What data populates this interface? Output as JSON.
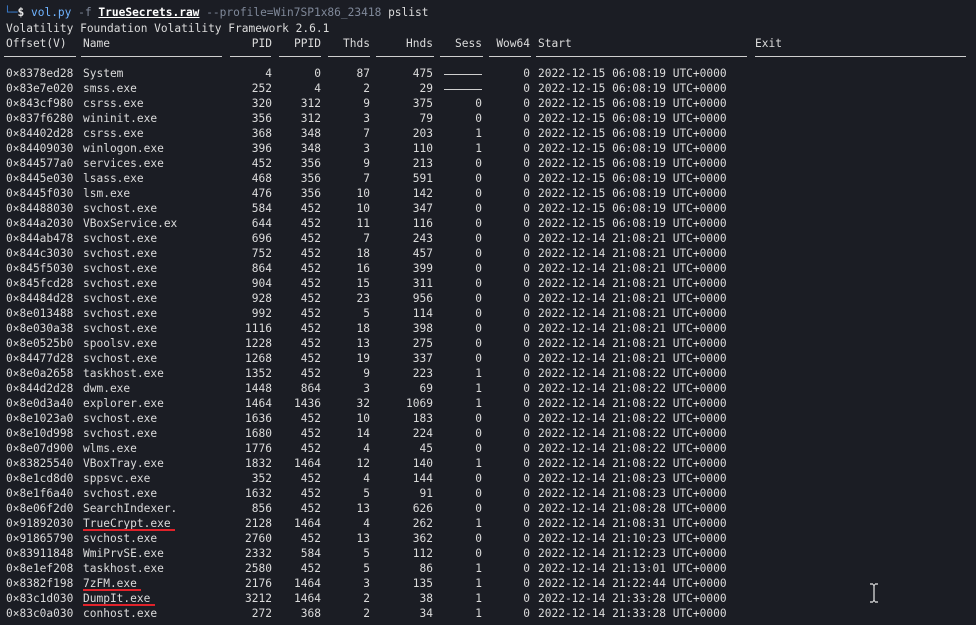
{
  "command": {
    "prompt_prefix": "└─",
    "prompt_symbol": "$",
    "executable": "vol.py",
    "flag_f": "-f",
    "file": "TrueSecrets.raw",
    "profile_arg": "--profile=Win7SP1x86_23418",
    "plugin": "pslist"
  },
  "banner": "Volatility Foundation Volatility Framework 2.6.1",
  "columns": [
    "Offset(V)",
    "Name",
    "PID",
    "PPID",
    "Thds",
    "Hnds",
    "Sess",
    "Wow64",
    "Start",
    "Exit"
  ],
  "rows": [
    {
      "offset": "0×8378ed28",
      "name": "System",
      "pid": "4",
      "ppid": "0",
      "thds": "87",
      "hnds": "475",
      "sess": "—",
      "wow64": "0",
      "start": "2022-12-15 06:08:19 UTC+0000",
      "exit": ""
    },
    {
      "offset": "0×83e7e020",
      "name": "smss.exe",
      "pid": "252",
      "ppid": "4",
      "thds": "2",
      "hnds": "29",
      "sess": "—",
      "wow64": "0",
      "start": "2022-12-15 06:08:19 UTC+0000",
      "exit": ""
    },
    {
      "offset": "0×843cf980",
      "name": "csrss.exe",
      "pid": "320",
      "ppid": "312",
      "thds": "9",
      "hnds": "375",
      "sess": "0",
      "wow64": "0",
      "start": "2022-12-15 06:08:19 UTC+0000",
      "exit": ""
    },
    {
      "offset": "0×837f6280",
      "name": "wininit.exe",
      "pid": "356",
      "ppid": "312",
      "thds": "3",
      "hnds": "79",
      "sess": "0",
      "wow64": "0",
      "start": "2022-12-15 06:08:19 UTC+0000",
      "exit": ""
    },
    {
      "offset": "0×84402d28",
      "name": "csrss.exe",
      "pid": "368",
      "ppid": "348",
      "thds": "7",
      "hnds": "203",
      "sess": "1",
      "wow64": "0",
      "start": "2022-12-15 06:08:19 UTC+0000",
      "exit": ""
    },
    {
      "offset": "0×84409030",
      "name": "winlogon.exe",
      "pid": "396",
      "ppid": "348",
      "thds": "3",
      "hnds": "110",
      "sess": "1",
      "wow64": "0",
      "start": "2022-12-15 06:08:19 UTC+0000",
      "exit": ""
    },
    {
      "offset": "0×844577a0",
      "name": "services.exe",
      "pid": "452",
      "ppid": "356",
      "thds": "9",
      "hnds": "213",
      "sess": "0",
      "wow64": "0",
      "start": "2022-12-15 06:08:19 UTC+0000",
      "exit": ""
    },
    {
      "offset": "0×8445e030",
      "name": "lsass.exe",
      "pid": "468",
      "ppid": "356",
      "thds": "7",
      "hnds": "591",
      "sess": "0",
      "wow64": "0",
      "start": "2022-12-15 06:08:19 UTC+0000",
      "exit": ""
    },
    {
      "offset": "0×8445f030",
      "name": "lsm.exe",
      "pid": "476",
      "ppid": "356",
      "thds": "10",
      "hnds": "142",
      "sess": "0",
      "wow64": "0",
      "start": "2022-12-15 06:08:19 UTC+0000",
      "exit": ""
    },
    {
      "offset": "0×84488030",
      "name": "svchost.exe",
      "pid": "584",
      "ppid": "452",
      "thds": "10",
      "hnds": "347",
      "sess": "0",
      "wow64": "0",
      "start": "2022-12-15 06:08:19 UTC+0000",
      "exit": ""
    },
    {
      "offset": "0×844a2030",
      "name": "VBoxService.ex",
      "pid": "644",
      "ppid": "452",
      "thds": "11",
      "hnds": "116",
      "sess": "0",
      "wow64": "0",
      "start": "2022-12-15 06:08:19 UTC+0000",
      "exit": ""
    },
    {
      "offset": "0×844ab478",
      "name": "svchost.exe",
      "pid": "696",
      "ppid": "452",
      "thds": "7",
      "hnds": "243",
      "sess": "0",
      "wow64": "0",
      "start": "2022-12-14 21:08:21 UTC+0000",
      "exit": ""
    },
    {
      "offset": "0×844c3030",
      "name": "svchost.exe",
      "pid": "752",
      "ppid": "452",
      "thds": "18",
      "hnds": "457",
      "sess": "0",
      "wow64": "0",
      "start": "2022-12-14 21:08:21 UTC+0000",
      "exit": ""
    },
    {
      "offset": "0×845f5030",
      "name": "svchost.exe",
      "pid": "864",
      "ppid": "452",
      "thds": "16",
      "hnds": "399",
      "sess": "0",
      "wow64": "0",
      "start": "2022-12-14 21:08:21 UTC+0000",
      "exit": ""
    },
    {
      "offset": "0×845fcd28",
      "name": "svchost.exe",
      "pid": "904",
      "ppid": "452",
      "thds": "15",
      "hnds": "311",
      "sess": "0",
      "wow64": "0",
      "start": "2022-12-14 21:08:21 UTC+0000",
      "exit": ""
    },
    {
      "offset": "0×84484d28",
      "name": "svchost.exe",
      "pid": "928",
      "ppid": "452",
      "thds": "23",
      "hnds": "956",
      "sess": "0",
      "wow64": "0",
      "start": "2022-12-14 21:08:21 UTC+0000",
      "exit": ""
    },
    {
      "offset": "0×8e013488",
      "name": "svchost.exe",
      "pid": "992",
      "ppid": "452",
      "thds": "5",
      "hnds": "114",
      "sess": "0",
      "wow64": "0",
      "start": "2022-12-14 21:08:21 UTC+0000",
      "exit": ""
    },
    {
      "offset": "0×8e030a38",
      "name": "svchost.exe",
      "pid": "1116",
      "ppid": "452",
      "thds": "18",
      "hnds": "398",
      "sess": "0",
      "wow64": "0",
      "start": "2022-12-14 21:08:21 UTC+0000",
      "exit": ""
    },
    {
      "offset": "0×8e0525b0",
      "name": "spoolsv.exe",
      "pid": "1228",
      "ppid": "452",
      "thds": "13",
      "hnds": "275",
      "sess": "0",
      "wow64": "0",
      "start": "2022-12-14 21:08:21 UTC+0000",
      "exit": ""
    },
    {
      "offset": "0×84477d28",
      "name": "svchost.exe",
      "pid": "1268",
      "ppid": "452",
      "thds": "19",
      "hnds": "337",
      "sess": "0",
      "wow64": "0",
      "start": "2022-12-14 21:08:21 UTC+0000",
      "exit": ""
    },
    {
      "offset": "0×8e0a2658",
      "name": "taskhost.exe",
      "pid": "1352",
      "ppid": "452",
      "thds": "9",
      "hnds": "223",
      "sess": "1",
      "wow64": "0",
      "start": "2022-12-14 21:08:22 UTC+0000",
      "exit": ""
    },
    {
      "offset": "0×844d2d28",
      "name": "dwm.exe",
      "pid": "1448",
      "ppid": "864",
      "thds": "3",
      "hnds": "69",
      "sess": "1",
      "wow64": "0",
      "start": "2022-12-14 21:08:22 UTC+0000",
      "exit": ""
    },
    {
      "offset": "0×8e0d3a40",
      "name": "explorer.exe",
      "pid": "1464",
      "ppid": "1436",
      "thds": "32",
      "hnds": "1069",
      "sess": "1",
      "wow64": "0",
      "start": "2022-12-14 21:08:22 UTC+0000",
      "exit": ""
    },
    {
      "offset": "0×8e1023a0",
      "name": "svchost.exe",
      "pid": "1636",
      "ppid": "452",
      "thds": "10",
      "hnds": "183",
      "sess": "0",
      "wow64": "0",
      "start": "2022-12-14 21:08:22 UTC+0000",
      "exit": ""
    },
    {
      "offset": "0×8e10d998",
      "name": "svchost.exe",
      "pid": "1680",
      "ppid": "452",
      "thds": "14",
      "hnds": "224",
      "sess": "0",
      "wow64": "0",
      "start": "2022-12-14 21:08:22 UTC+0000",
      "exit": ""
    },
    {
      "offset": "0×8e07d900",
      "name": "wlms.exe",
      "pid": "1776",
      "ppid": "452",
      "thds": "4",
      "hnds": "45",
      "sess": "0",
      "wow64": "0",
      "start": "2022-12-14 21:08:22 UTC+0000",
      "exit": ""
    },
    {
      "offset": "0×83825540",
      "name": "VBoxTray.exe",
      "pid": "1832",
      "ppid": "1464",
      "thds": "12",
      "hnds": "140",
      "sess": "1",
      "wow64": "0",
      "start": "2022-12-14 21:08:22 UTC+0000",
      "exit": ""
    },
    {
      "offset": "0×8e1cd8d0",
      "name": "sppsvc.exe",
      "pid": "352",
      "ppid": "452",
      "thds": "4",
      "hnds": "144",
      "sess": "0",
      "wow64": "0",
      "start": "2022-12-14 21:08:23 UTC+0000",
      "exit": ""
    },
    {
      "offset": "0×8e1f6a40",
      "name": "svchost.exe",
      "pid": "1632",
      "ppid": "452",
      "thds": "5",
      "hnds": "91",
      "sess": "0",
      "wow64": "0",
      "start": "2022-12-14 21:08:23 UTC+0000",
      "exit": ""
    },
    {
      "offset": "0×8e06f2d0",
      "name": "SearchIndexer.",
      "pid": "856",
      "ppid": "452",
      "thds": "13",
      "hnds": "626",
      "sess": "0",
      "wow64": "0",
      "start": "2022-12-14 21:08:28 UTC+0000",
      "exit": ""
    },
    {
      "offset": "0×91892030",
      "name": "TrueCrypt.exe",
      "pid": "2128",
      "ppid": "1464",
      "thds": "4",
      "hnds": "262",
      "sess": "1",
      "wow64": "0",
      "start": "2022-12-14 21:08:31 UTC+0000",
      "exit": "",
      "highlight": true
    },
    {
      "offset": "0×91865790",
      "name": "svchost.exe",
      "pid": "2760",
      "ppid": "452",
      "thds": "13",
      "hnds": "362",
      "sess": "0",
      "wow64": "0",
      "start": "2022-12-14 21:10:23 UTC+0000",
      "exit": ""
    },
    {
      "offset": "0×83911848",
      "name": "WmiPrvSE.exe",
      "pid": "2332",
      "ppid": "584",
      "thds": "5",
      "hnds": "112",
      "sess": "0",
      "wow64": "0",
      "start": "2022-12-14 21:12:23 UTC+0000",
      "exit": ""
    },
    {
      "offset": "0×8e1ef208",
      "name": "taskhost.exe",
      "pid": "2580",
      "ppid": "452",
      "thds": "5",
      "hnds": "86",
      "sess": "1",
      "wow64": "0",
      "start": "2022-12-14 21:13:01 UTC+0000",
      "exit": ""
    },
    {
      "offset": "0×8382f198",
      "name": "7zFM.exe",
      "pid": "2176",
      "ppid": "1464",
      "thds": "3",
      "hnds": "135",
      "sess": "1",
      "wow64": "0",
      "start": "2022-12-14 21:22:44 UTC+0000",
      "exit": "",
      "highlight": true
    },
    {
      "offset": "0×83c1d030",
      "name": "DumpIt.exe",
      "pid": "3212",
      "ppid": "1464",
      "thds": "2",
      "hnds": "38",
      "sess": "1",
      "wow64": "0",
      "start": "2022-12-14 21:33:28 UTC+0000",
      "exit": "",
      "highlight": true
    },
    {
      "offset": "0×83c0a030",
      "name": "conhost.exe",
      "pid": "272",
      "ppid": "368",
      "thds": "2",
      "hnds": "34",
      "sess": "1",
      "wow64": "0",
      "start": "2022-12-14 21:33:28 UTC+0000",
      "exit": ""
    }
  ],
  "colors": {
    "background": "#1b1d24",
    "text": "#dcdcdc",
    "prompt": "#3b82d8",
    "executable": "#6fb3ff",
    "flag": "#7f8899",
    "highlight_underline": "#e0222a"
  }
}
